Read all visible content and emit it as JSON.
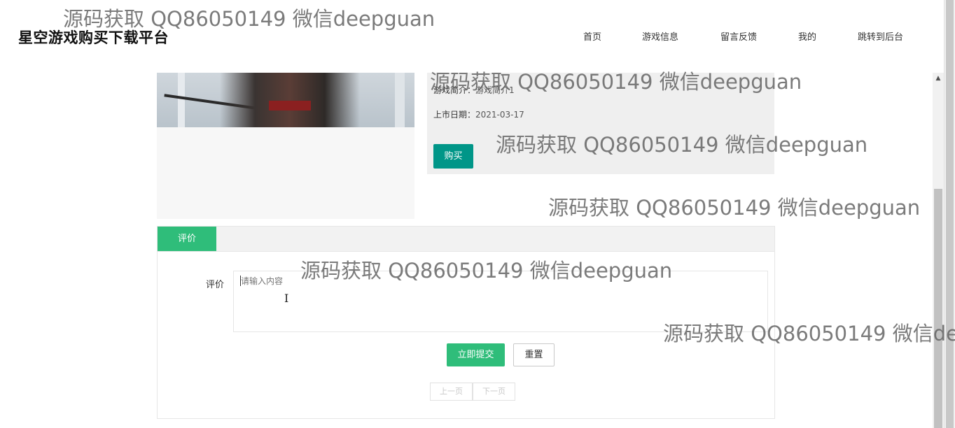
{
  "header": {
    "brand": "星空游戏购买下载平台",
    "nav": [
      "首页",
      "游戏信息",
      "留言反馈",
      "我的",
      "跳转到后台"
    ]
  },
  "game": {
    "intro_label": "游戏简介：",
    "intro_value": "游戏简介1",
    "release_label": "上市日期：",
    "release_value": "2021-03-17",
    "buy_label": "购买"
  },
  "review": {
    "tab_label": "评价",
    "field_label": "评价",
    "placeholder": "请输入内容",
    "submit_label": "立即提交",
    "reset_label": "重置",
    "prev_label": "上一页",
    "next_label": "下一页"
  },
  "scrollbar": {
    "up_icon": "arrow-up-icon"
  },
  "watermark": "源码获取 QQ86050149 微信deepguan",
  "colors": {
    "primary_teal": "#009688",
    "accent_green": "#2fbd7a"
  }
}
